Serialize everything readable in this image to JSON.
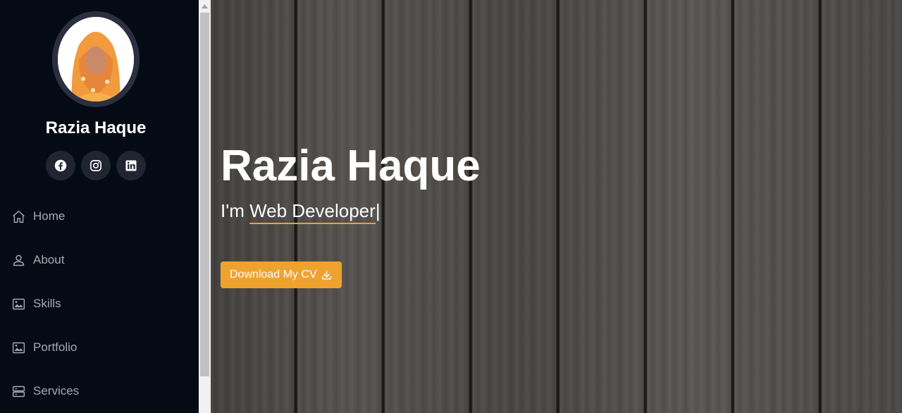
{
  "profile": {
    "name": "Razia Haque"
  },
  "social": {
    "items": [
      "facebook-icon",
      "instagram-icon",
      "linkedin-icon"
    ]
  },
  "nav": {
    "items": [
      {
        "label": "Home",
        "icon": "home-icon"
      },
      {
        "label": "About",
        "icon": "user-icon"
      },
      {
        "label": "Skills",
        "icon": "image-icon"
      },
      {
        "label": "Portfolio",
        "icon": "image-icon"
      },
      {
        "label": "Services",
        "icon": "server-icon"
      }
    ]
  },
  "hero": {
    "name": "Razia Haque",
    "prefix": "I'm ",
    "typed": "Web Developer",
    "cursor": "|",
    "cv_button": "Download My CV"
  },
  "colors": {
    "accent": "#f0a22e",
    "sidebar_bg": "#040b14",
    "nav_text": "#a8a9b4"
  }
}
